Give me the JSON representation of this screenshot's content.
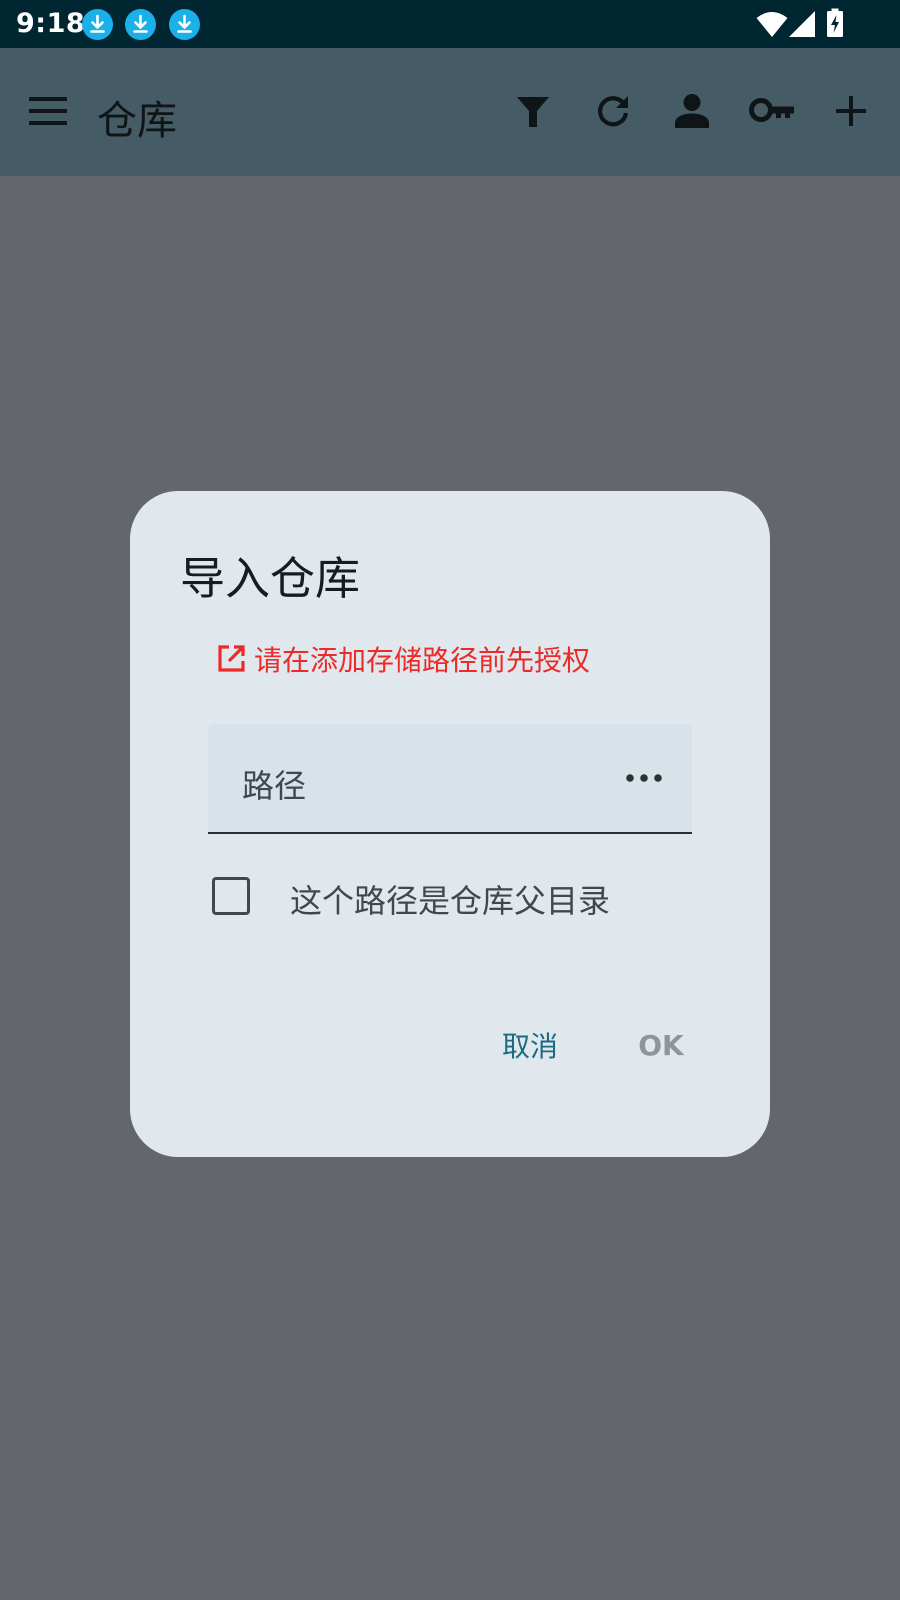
{
  "status_bar": {
    "time": "9:18",
    "notification_icons": [
      "download-icon",
      "download-icon",
      "download-icon"
    ],
    "system_icons": [
      "wifi-icon",
      "signal-icon",
      "battery-charging-icon"
    ]
  },
  "app_bar": {
    "title": "仓库",
    "menu_icon": "menu-icon",
    "actions": [
      "filter-icon",
      "refresh-icon",
      "person-icon",
      "key-icon",
      "add-icon"
    ]
  },
  "dialog": {
    "title": "导入仓库",
    "authorize_link": "请在添加存储路径前先授权",
    "path_field": {
      "label": "路径",
      "value": ""
    },
    "parent_dir_checkbox": {
      "label": "这个路径是仓库父目录",
      "checked": false
    },
    "buttons": {
      "cancel": "取消",
      "ok": "OK"
    }
  },
  "colors": {
    "status_bar_bg": "#002631",
    "app_bar_bg": "#455c67",
    "scrim_bg": "#63666a",
    "dialog_bg": "#e0e8ed",
    "field_bg": "#d8e2e9",
    "error_text": "#ec2a2a",
    "primary": "#1c6a80",
    "disabled": "#8e969a",
    "download_badge": "#1bb0ea"
  }
}
